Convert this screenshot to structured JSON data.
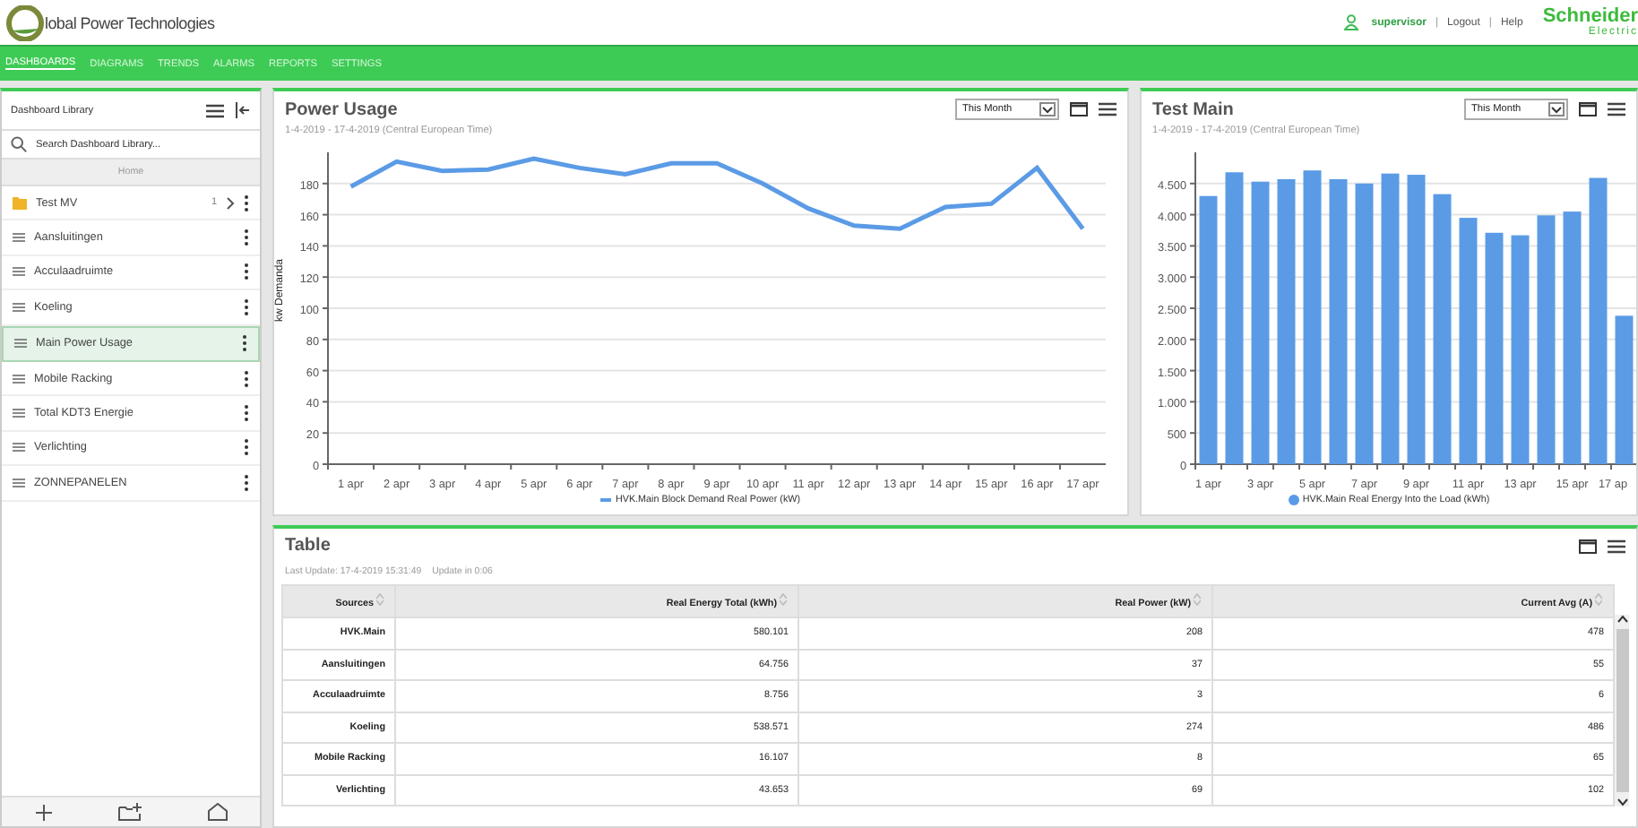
{
  "header": {
    "logo_text": "lobal Power Technologies",
    "user": "supervisor",
    "links": [
      "Logout",
      "Help"
    ],
    "separator": "|",
    "brand": [
      "Schneider",
      "Electric"
    ]
  },
  "nav": [
    {
      "label": "DASHBOARDS",
      "selected": true
    },
    {
      "label": "DIAGRAMS",
      "selected": false
    },
    {
      "label": "TRENDS",
      "selected": false
    },
    {
      "label": "ALARMS",
      "selected": false
    },
    {
      "label": "REPORTS",
      "selected": false
    },
    {
      "label": "SETTINGS",
      "selected": false
    }
  ],
  "sidebar": {
    "title": "Dashboard Library",
    "search": {
      "placeholder": "Search Dashboard Library..."
    },
    "breadcrumb": "Home",
    "items": [
      {
        "kind": "folder",
        "label": "Test MV",
        "count": "1",
        "selected": false
      },
      {
        "kind": "dashboard",
        "label": "Aansluitingen",
        "selected": false
      },
      {
        "kind": "dashboard",
        "label": "Acculaadruimte",
        "selected": false
      },
      {
        "kind": "dashboard",
        "label": "Koeling",
        "selected": false
      },
      {
        "kind": "dashboard",
        "label": "Main Power Usage",
        "selected": true
      },
      {
        "kind": "dashboard",
        "label": "Mobile Racking",
        "selected": false
      },
      {
        "kind": "dashboard",
        "label": "Total KDT3 Energie",
        "selected": false
      },
      {
        "kind": "dashboard",
        "label": "Verlichting",
        "selected": false
      },
      {
        "kind": "dashboard",
        "label": "ZONNEPANELEN",
        "selected": false
      }
    ]
  },
  "panels": [
    {
      "title": "Power Usage",
      "period": "This Month",
      "range": "1-4-2019 - 17-4-2019 (Central European Time)",
      "chart_data": {
        "type": "line",
        "grid": true,
        "ylabel": "kw Demanda",
        "categories": [
          "1 apr",
          "2 apr",
          "3 apr",
          "4 apr",
          "5 apr",
          "6 apr",
          "7 apr",
          "8 apr",
          "9 apr",
          "10 apr",
          "11 apr",
          "12 apr",
          "13 apr",
          "14 apr",
          "15 apr",
          "16 apr",
          "17 apr"
        ],
        "ylim": [
          0,
          200
        ],
        "yticks": [
          0,
          20,
          40,
          60,
          80,
          100,
          120,
          140,
          160,
          180
        ],
        "series": [
          {
            "name": "HVK.Main Block Demand Real Power (kW)",
            "color": "#5b9be6",
            "values": [
              178,
              194,
              188,
              189,
              196,
              190,
              186,
              193,
              193,
              180,
              164,
              153,
              151,
              165,
              167,
              190,
              151
            ]
          }
        ]
      }
    },
    {
      "title": "Test Main",
      "period": "This Month",
      "range": "1-4-2019 - 17-4-2019 (Central European Time)",
      "chart_data": {
        "type": "bar",
        "grid": true,
        "categories": [
          "1 apr",
          null,
          "3 apr",
          null,
          "5 apr",
          null,
          "7 apr",
          null,
          "9 apr",
          null,
          "11 apr",
          null,
          "13 apr",
          null,
          "15 apr",
          null,
          "17 ap"
        ],
        "ylim": [
          0,
          5000
        ],
        "yticks": [
          {
            "value": 0,
            "label": "0"
          },
          {
            "value": 500,
            "label": "500"
          },
          {
            "value": 1000,
            "label": "1.000"
          },
          {
            "value": 1500,
            "label": "1.500"
          },
          {
            "value": 2000,
            "label": "2.000"
          },
          {
            "value": 2500,
            "label": "2.500"
          },
          {
            "value": 3000,
            "label": "3.000"
          },
          {
            "value": 3500,
            "label": "3.500"
          },
          {
            "value": 4000,
            "label": "4.000"
          },
          {
            "value": 4500,
            "label": "4.500"
          }
        ],
        "series": [
          {
            "name": "HVK.Main Real Energy Into the Load (kWh)",
            "color": "#5b9be6",
            "values": [
              4300,
              4680,
              4530,
              4570,
              4710,
              4570,
              4500,
              4660,
              4640,
              4330,
              3950,
              3710,
              3670,
              3990,
              4050,
              4590,
              2380
            ]
          }
        ]
      }
    }
  ],
  "table": {
    "title": "Table",
    "last_update": "Last Update: 17-4-2019 15:31:49",
    "update_in": "Update in 0:06",
    "columns": [
      "Sources",
      "Real Energy Total (kWh)",
      "Real Power (kW)",
      "Current Avg (A)"
    ],
    "rows": [
      [
        "HVK.Main",
        "580.101",
        "208",
        "478"
      ],
      [
        "Aansluitingen",
        "64.756",
        "37",
        "55"
      ],
      [
        "Acculaadruimte",
        "8.756",
        "3",
        "6"
      ],
      [
        "Koeling",
        "538.571",
        "274",
        "486"
      ],
      [
        "Mobile Racking",
        "16.107",
        "8",
        "65"
      ],
      [
        "Verlichting",
        "43.653",
        "69",
        "102"
      ]
    ]
  }
}
